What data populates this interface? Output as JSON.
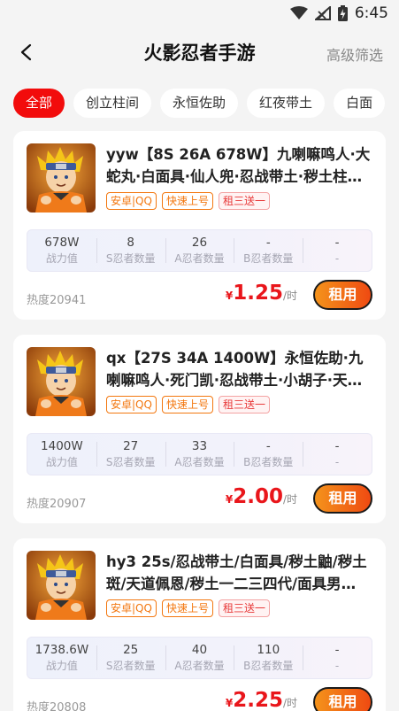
{
  "status": {
    "time": "6:45"
  },
  "header": {
    "title": "火影忍者手游",
    "filter_label": "高级筛选"
  },
  "tabs": [
    "全部",
    "创立柱间",
    "永恒佐助",
    "红夜带土",
    "白面"
  ],
  "stat_labels": [
    "战力值",
    "S忍者数量",
    "A忍者数量",
    "B忍者数量",
    "-"
  ],
  "rent_label": "租用",
  "price_unit": "/时",
  "currency": "¥",
  "tags": [
    "安卓|QQ",
    "快速上号",
    "租三送一"
  ],
  "items": [
    {
      "title": "yyw【8S 26A 678W】九喇嘛鸣人·大蛇丸·白面具·仙人兜·忍战带土·秽土柱间…",
      "stats": [
        "678W",
        "8",
        "26",
        "-",
        "-"
      ],
      "heat": "热度20941",
      "price": "1.25"
    },
    {
      "title": "qx【27S 34A 1400W】永恒佐助·九喇嘛鸣人·死门凯·忍战带土·小胡子·天道…",
      "stats": [
        "1400W",
        "27",
        "33",
        "-",
        "-"
      ],
      "heat": "热度20907",
      "price": "2.00"
    },
    {
      "title": "hy3 25s/忍战带土/白面具/秽土鼬/秽土斑/天道佩恩/秽土一二三四代/面具男…",
      "stats": [
        "1738.6W",
        "25",
        "40",
        "110",
        "-"
      ],
      "heat": "热度20808",
      "price": "2.25"
    }
  ]
}
